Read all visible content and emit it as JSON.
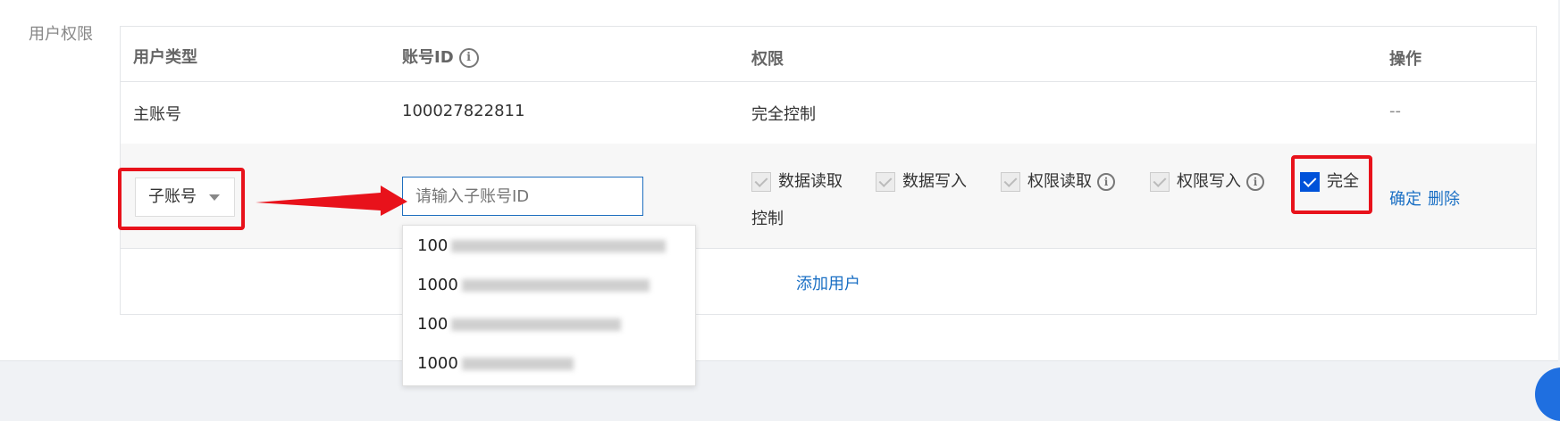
{
  "section": {
    "label": "用户权限"
  },
  "table": {
    "headers": {
      "user_type": "用户类型",
      "account_id": "账号ID",
      "permission": "权限",
      "action": "操作"
    },
    "main_row": {
      "user_type": "主账号",
      "account_id": "100027822811",
      "permission": "完全控制",
      "action": "--"
    },
    "edit_row": {
      "user_type_select": "子账号",
      "account_placeholder": "请输入子账号ID",
      "checkboxes": [
        {
          "label": "数据读取",
          "checked": true,
          "disabled": true
        },
        {
          "label": "数据写入",
          "checked": true,
          "disabled": true
        },
        {
          "label": "权限读取",
          "checked": true,
          "disabled": true
        },
        {
          "label": "权限写入",
          "checked": true,
          "disabled": true
        },
        {
          "label": "完全控制",
          "checked": true,
          "disabled": false
        }
      ],
      "full_label_line1": "完全",
      "full_label_line2": "控制",
      "confirm": "确定",
      "delete": "删除"
    },
    "add_user": "添加用户"
  },
  "dropdown": {
    "options": [
      "100",
      "1000",
      "100",
      "1000"
    ]
  },
  "colors": {
    "accent": "#0052d9",
    "link": "#1a6fc4",
    "highlight": "#e8121b"
  }
}
